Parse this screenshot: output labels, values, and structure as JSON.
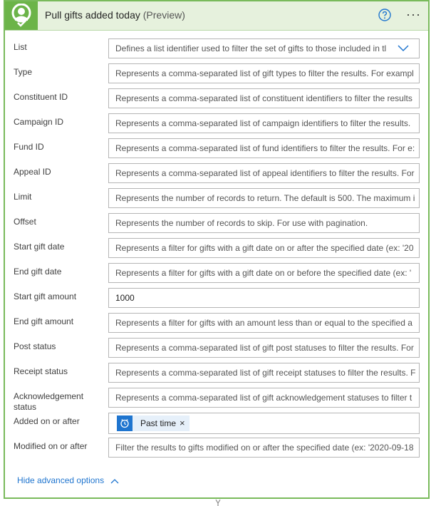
{
  "header": {
    "title": "Pull gifts added today",
    "preview": "(Preview)",
    "logo_icon": "check-person-icon",
    "help_icon": "help-icon",
    "more_icon": "more-options-icon",
    "more_glyph": "···",
    "accent_color": "#6cb449"
  },
  "fields": [
    {
      "label": "List",
      "text": "Defines a list identifier used to filter the set of gifts to those included in tl",
      "kind": "select"
    },
    {
      "label": "Type",
      "text": "Represents a comma-separated list of gift types to filter the results. For exampl",
      "kind": "placeholder"
    },
    {
      "label": "Constituent ID",
      "text": "Represents a comma-separated list of constituent identifiers to filter the results",
      "kind": "placeholder"
    },
    {
      "label": "Campaign ID",
      "text": "Represents a comma-separated list of campaign identifiers to filter the results.",
      "kind": "placeholder"
    },
    {
      "label": "Fund ID",
      "text": "Represents a comma-separated list of fund identifiers to filter the results. For e:",
      "kind": "placeholder"
    },
    {
      "label": "Appeal ID",
      "text": "Represents a comma-separated list of appeal identifiers to filter the results. For",
      "kind": "placeholder"
    },
    {
      "label": "Limit",
      "text": "Represents the number of records to return. The default is 500. The maximum i",
      "kind": "placeholder"
    },
    {
      "label": "Offset",
      "text": "Represents the number of records to skip. For use with pagination.",
      "kind": "placeholder"
    },
    {
      "label": "Start gift date",
      "text": "Represents a filter for gifts with a gift date on or after the specified date (ex: '20",
      "kind": "placeholder"
    },
    {
      "label": "End gift date",
      "text": "Represents a filter for gifts with a gift date on or before the specified date (ex: '",
      "kind": "placeholder"
    },
    {
      "label": "Start gift amount",
      "text": "1000",
      "kind": "value"
    },
    {
      "label": "End gift amount",
      "text": "Represents a filter for gifts with an amount less than or equal to the specified a",
      "kind": "placeholder"
    },
    {
      "label": "Post status",
      "text": "Represents a comma-separated list of gift post statuses to filter the results. For",
      "kind": "placeholder"
    },
    {
      "label": "Receipt status",
      "text": "Represents a comma-separated list of gift receipt statuses to filter the results. F",
      "kind": "placeholder"
    },
    {
      "label": "Acknowledgement status",
      "text": "Represents a comma-separated list of gift acknowledgement statuses to filter t",
      "kind": "placeholder"
    },
    {
      "label": "Added on or after",
      "text": "",
      "kind": "token",
      "token_label": "Past time",
      "token_icon": "clock-icon",
      "token_close": "×"
    },
    {
      "label": "Modified on or after",
      "text": "Filter the results to gifts modified on or after the specified date (ex: '2020-09-18",
      "kind": "placeholder"
    }
  ],
  "footer": {
    "toggle_label": "Hide advanced options",
    "toggle_icon": "chevron-up-icon",
    "link_color": "#1f75cf"
  }
}
